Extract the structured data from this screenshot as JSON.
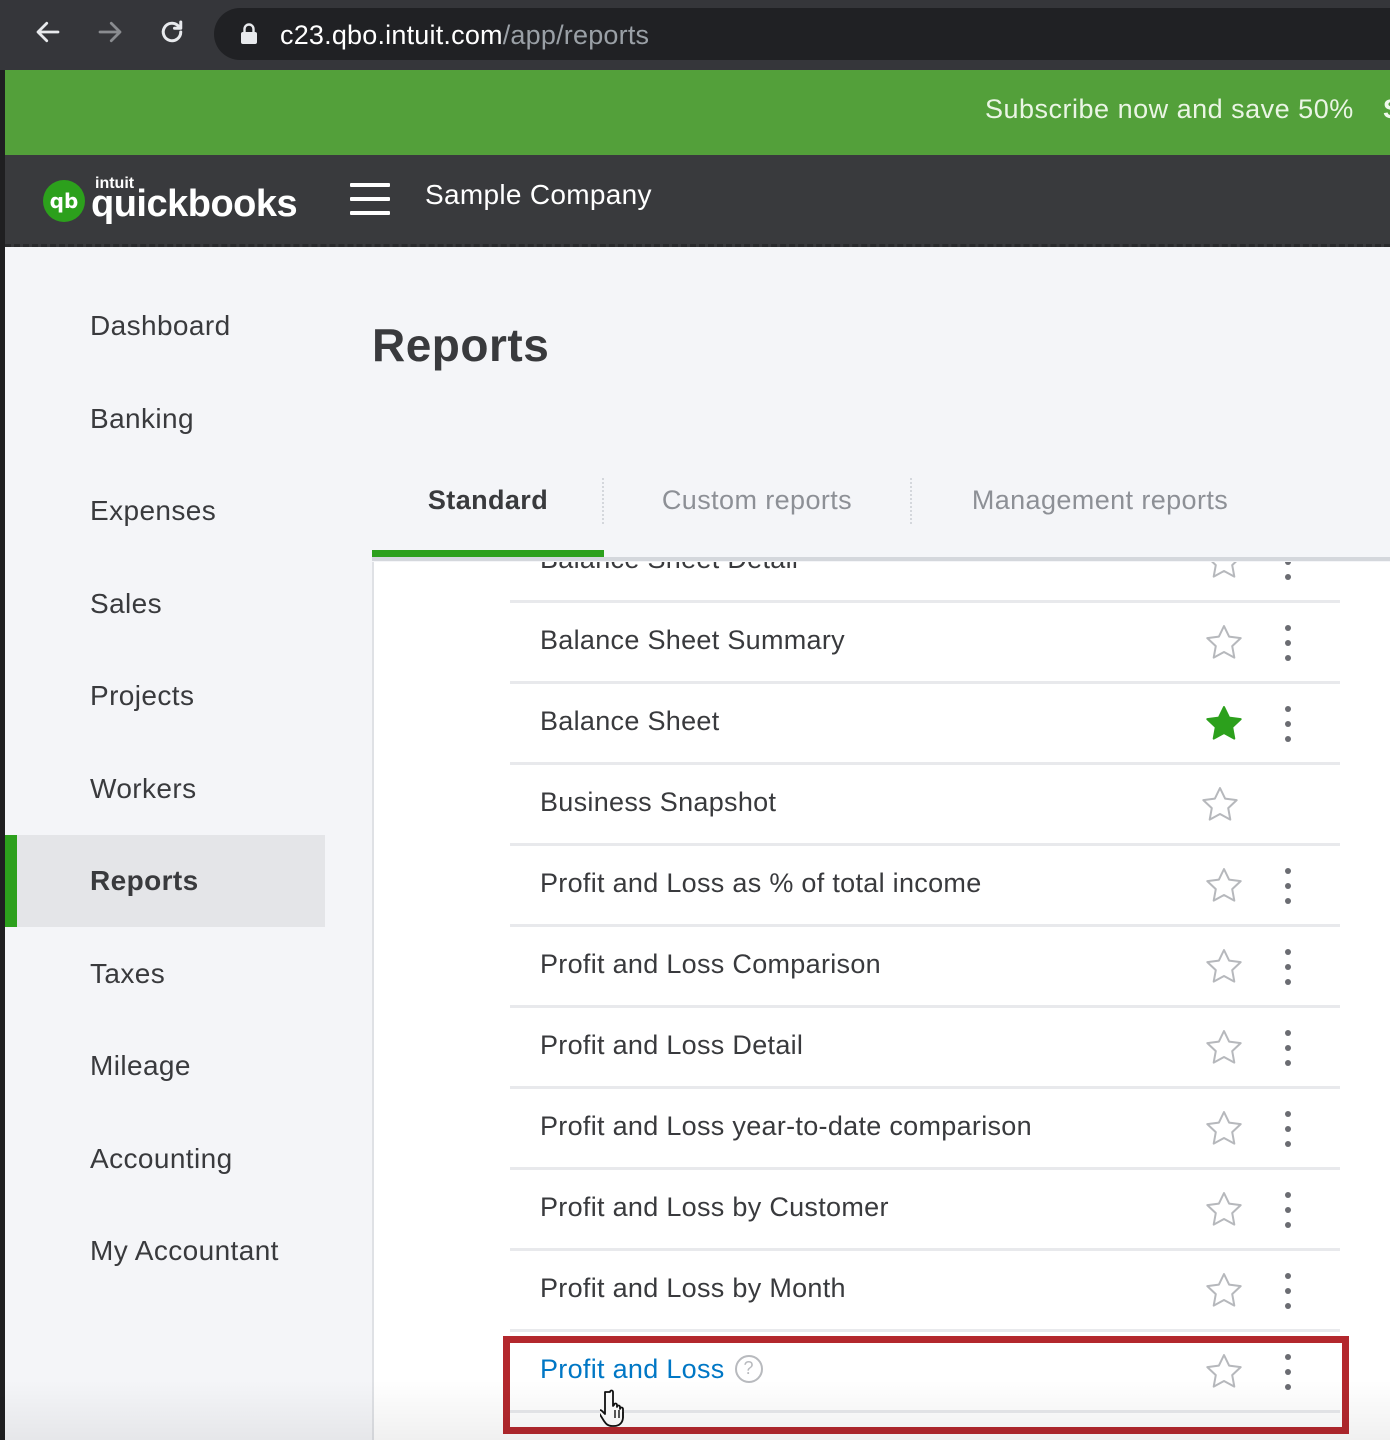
{
  "browser": {
    "url_host": "c23.qbo.intuit.com",
    "url_path": "/app/reports"
  },
  "promo": {
    "text": "Subscribe now and save 50%",
    "extra": "S"
  },
  "header": {
    "logo_intuit": "intuit",
    "logo_name": "quickbooks",
    "logo_mark": "qb",
    "company": "Sample Company"
  },
  "sidebar": {
    "items": [
      {
        "label": "Dashboard",
        "active": false
      },
      {
        "label": "Banking",
        "active": false
      },
      {
        "label": "Expenses",
        "active": false
      },
      {
        "label": "Sales",
        "active": false
      },
      {
        "label": "Projects",
        "active": false
      },
      {
        "label": "Workers",
        "active": false
      },
      {
        "label": "Reports",
        "active": true
      },
      {
        "label": "Taxes",
        "active": false
      },
      {
        "label": "Mileage",
        "active": false
      },
      {
        "label": "Accounting",
        "active": false
      },
      {
        "label": "My Accountant",
        "active": false
      }
    ]
  },
  "main": {
    "title": "Reports",
    "tabs": [
      {
        "label": "Standard",
        "active": true
      },
      {
        "label": "Custom reports",
        "active": false
      },
      {
        "label": "Management reports",
        "active": false
      }
    ],
    "reports": [
      {
        "label": "Balance Sheet Detail",
        "favorite": false,
        "menu": true
      },
      {
        "label": "Balance Sheet Summary",
        "favorite": false,
        "menu": true
      },
      {
        "label": "Balance Sheet",
        "favorite": true,
        "menu": true
      },
      {
        "label": "Business Snapshot",
        "favorite": false,
        "menu": false
      },
      {
        "label": "Profit and Loss as % of total income",
        "favorite": false,
        "menu": true
      },
      {
        "label": "Profit and Loss Comparison",
        "favorite": false,
        "menu": true
      },
      {
        "label": "Profit and Loss Detail",
        "favorite": false,
        "menu": true
      },
      {
        "label": "Profit and Loss year-to-date comparison",
        "favorite": false,
        "menu": true
      },
      {
        "label": "Profit and Loss by Customer",
        "favorite": false,
        "menu": true
      },
      {
        "label": "Profit and Loss by Month",
        "favorite": false,
        "menu": true
      },
      {
        "label": "Profit and Loss",
        "favorite": false,
        "menu": true,
        "help": "?",
        "highlighted": true
      }
    ]
  },
  "colors": {
    "brand_green": "#2ca01c",
    "promo_green": "#53a03a",
    "header_dark": "#393a3d",
    "link_blue": "#0077c5",
    "highlight_red": "#b3282d"
  }
}
